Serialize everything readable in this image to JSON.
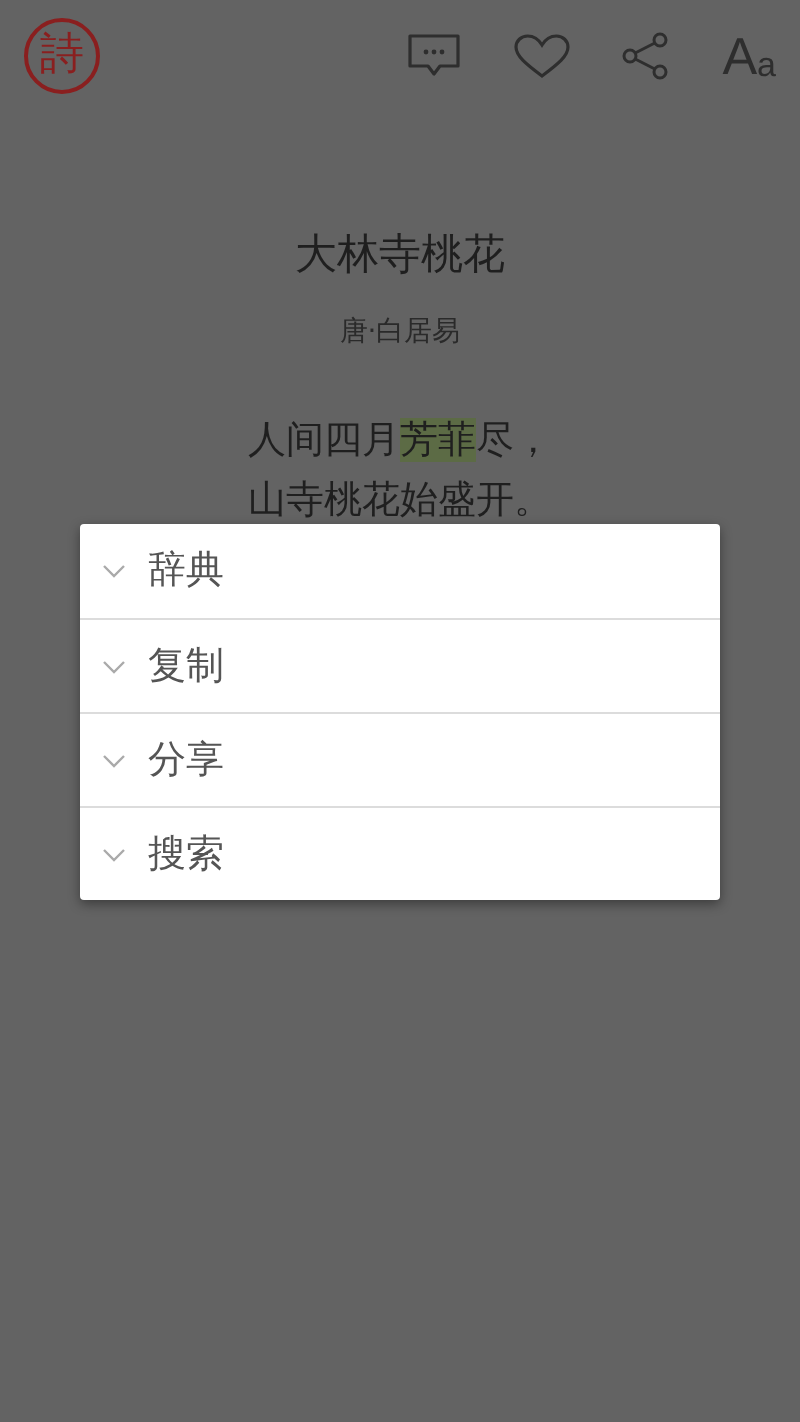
{
  "header": {
    "logo": "詩",
    "font_button": {
      "large": "A",
      "small": "a"
    }
  },
  "poem": {
    "title": "大林寺桃花",
    "author": "唐·白居易",
    "lines": [
      [
        {
          "text": "人间四月",
          "highlighted": false
        },
        {
          "text": "芳菲",
          "highlighted": true
        },
        {
          "text": "尽，",
          "highlighted": false
        }
      ],
      [
        {
          "text": "山寺桃花始盛开。",
          "highlighted": false
        }
      ]
    ]
  },
  "menu": {
    "items": [
      {
        "label": "辞典"
      },
      {
        "label": "复制"
      },
      {
        "label": "分享"
      },
      {
        "label": "搜索"
      }
    ]
  }
}
